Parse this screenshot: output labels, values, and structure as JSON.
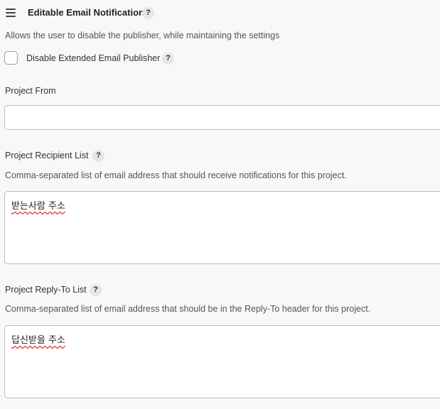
{
  "section": {
    "title": "Editable Email Notification",
    "help_glyph": "?",
    "description": "Allows the user to disable the publisher, while maintaining the settings"
  },
  "disable_publisher": {
    "label": "Disable Extended Email Publisher",
    "checked": false
  },
  "project_from": {
    "label": "Project From",
    "value": ""
  },
  "recipient_list": {
    "label": "Project Recipient List",
    "description": "Comma-separated list of email address that should receive notifications for this project.",
    "value": "받는사람 주소"
  },
  "reply_to_list": {
    "label": "Project Reply-To List",
    "description": "Comma-separated list of email address that should be in the Reply-To header for this project.",
    "value": "답신받을 주소"
  },
  "icons": {
    "drag_handle": "drag-handle-icon",
    "help": "help-icon"
  }
}
